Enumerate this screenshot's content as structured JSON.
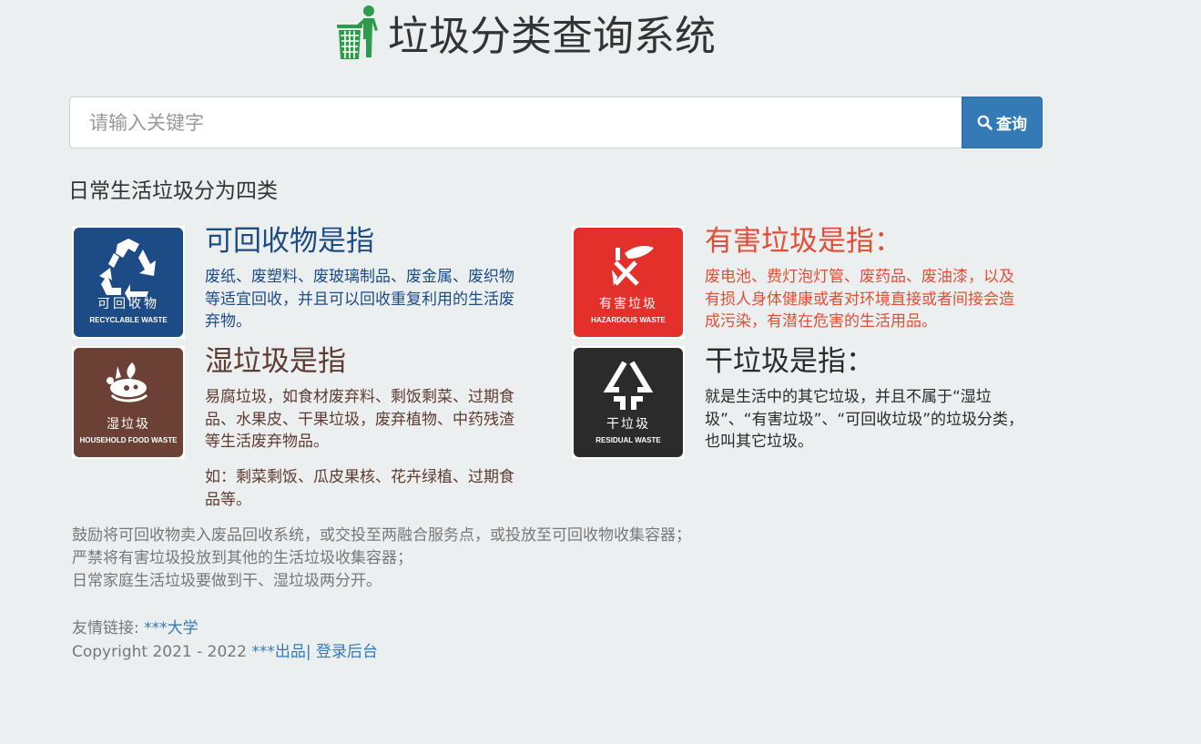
{
  "header": {
    "title": "垃圾分类查询系统",
    "logo_icon": "trash-can-person-logo-icon"
  },
  "search": {
    "placeholder": "请输入关键字",
    "value": "",
    "button_label": "查询",
    "button_icon": "search-icon",
    "button_color": "#337ab7"
  },
  "intro": "日常生活垃圾分为四类",
  "categories": [
    {
      "id": "recyclable",
      "image_cn": "可回收物",
      "image_en": "RECYCLABLE WASTE",
      "image_icon": "recycle-icon",
      "image_color": "#1c4b85",
      "title": "可回收物是指",
      "description": "废纸、废塑料、废玻璃制品、废金属、废织物等适宜回收，并且可以回收重复利用的生活废弃物。",
      "text_color": "#1c4b85"
    },
    {
      "id": "hazardous",
      "image_cn": "有害垃圾",
      "image_en": "HAZARDOUS WASTE",
      "image_icon": "hazard-icon",
      "image_color": "#e3302b",
      "title": "有害垃圾是指：",
      "description": "废电池、费灯泡灯管、废药品、废油漆，以及有损人身体健康或者对环境直接或者间接会造成污染，有潜在危害的生活用品。",
      "text_color": "#e24e35"
    },
    {
      "id": "wet",
      "image_cn": "湿垃圾",
      "image_en": "HOUSEHOLD FOOD WASTE",
      "image_icon": "food-waste-icon",
      "image_color": "#6b4035",
      "title": "湿垃圾是指",
      "description": "易腐垃圾，如食材废弃料、剩饭剩菜、过期食品、水果皮、干果垃圾，废弃植物、中药残渣等生活废弃物品。",
      "example": "如：剩菜剩饭、瓜皮果核、花卉绿植、过期食品等。",
      "text_color": "#5e3b31"
    },
    {
      "id": "dry",
      "image_cn": "干垃圾",
      "image_en": "RESIDUAL WASTE",
      "image_icon": "residual-waste-icon",
      "image_color": "#2b2b2b",
      "title": "干垃圾是指：",
      "description": "就是生活中的其它垃圾，并且不属于“湿垃圾”、“有害垃圾”、“可回收垃圾”的垃圾分类，也叫其它垃圾。",
      "text_color": "#2a2a2a"
    }
  ],
  "notes": [
    "鼓励将可回收物卖入废品回收系统，或交投至两融合服务点，或投放至可回收物收集容器；",
    "严禁将有害垃圾投放到其他的生活垃圾收集容器；",
    "日常家庭生活垃圾要做到干、湿垃圾两分开。"
  ],
  "footer": {
    "links_label": "友情链接: ",
    "link_text": "***大学",
    "copyright": "Copyright 2021 - 2022 ",
    "maker_link": "***出品",
    "separator": "|",
    "admin_link": " 登录后台"
  }
}
